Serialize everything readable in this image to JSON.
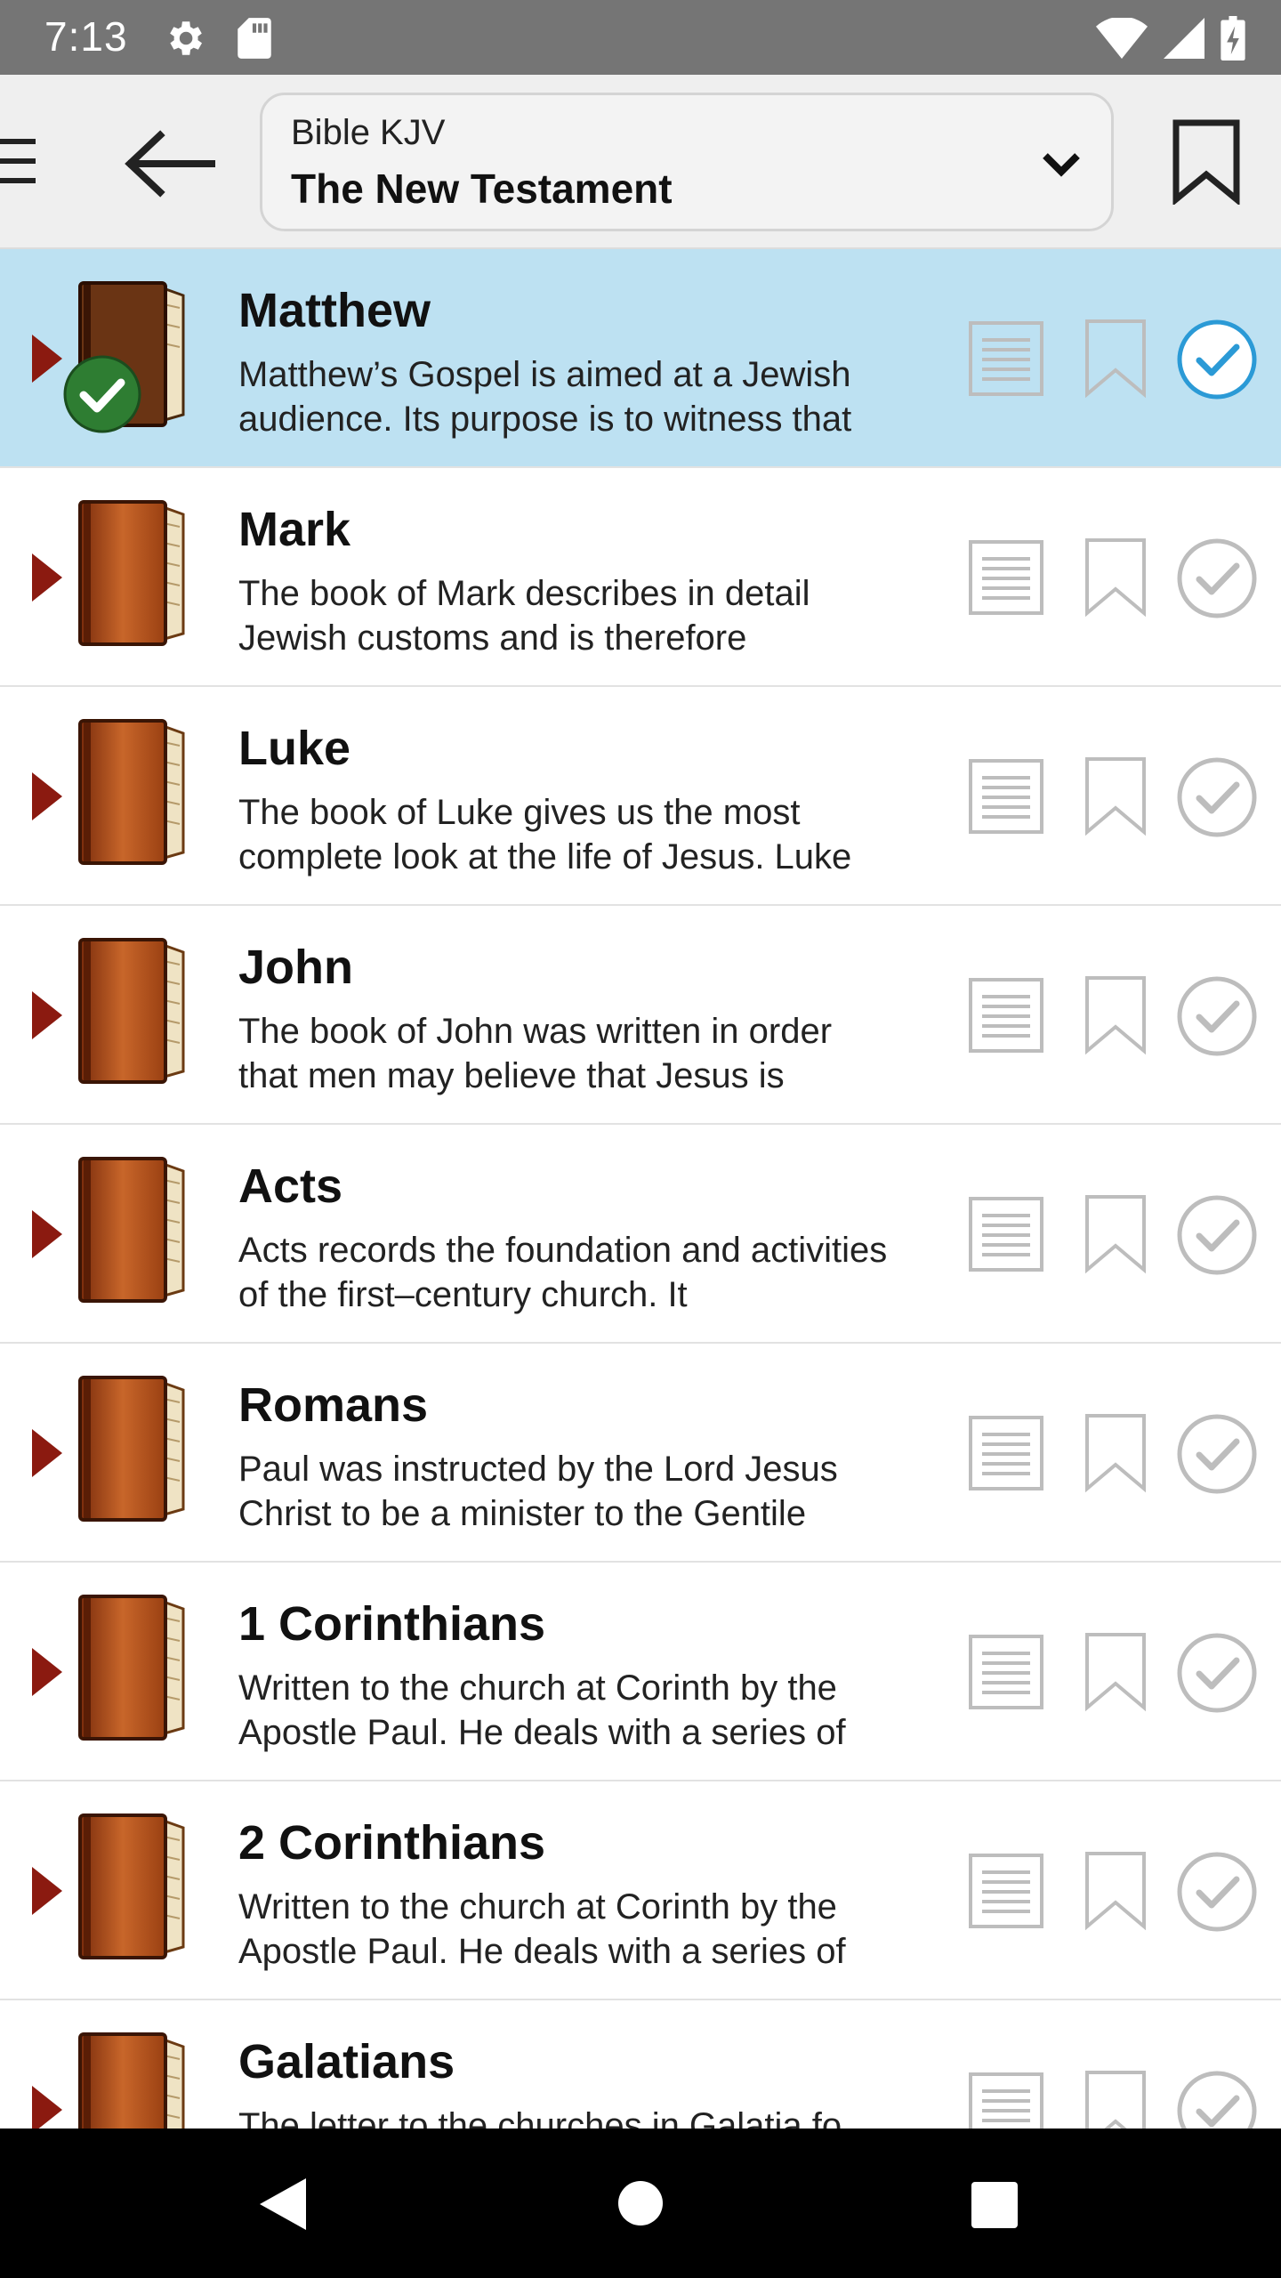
{
  "status_bar": {
    "time": "7:13",
    "icons": [
      "gear-icon",
      "sd-card-icon",
      "wifi-icon",
      "signal-icon",
      "battery-charging-icon"
    ]
  },
  "app_bar": {
    "menu_icon": "hamburger-menu-icon",
    "back_icon": "arrow-left-icon",
    "selector_subtitle": "Bible KJV",
    "selector_title": "The New Testament",
    "selector_icon": "chevron-down-icon",
    "bookmark_icon": "bookmark-icon"
  },
  "colors": {
    "status_bar": "#757575",
    "app_bar": "#efefef",
    "selected_row": "#bde1f2",
    "accent_blue": "#2b9ad6",
    "arrow_red": "#8b1a10",
    "book_brown": "#b8561b",
    "check_green": "#2e7d32",
    "icon_gray": "#bdbdbd"
  },
  "books": [
    {
      "name": "Matthew",
      "description": "Matthew’s Gospel is aimed at a Jewish audience. Its purpose is to witness that",
      "selected": true,
      "completed": true
    },
    {
      "name": "Mark",
      "description": "The book of Mark describes in detail Jewish customs and is therefore",
      "selected": false,
      "completed": false
    },
    {
      "name": "Luke",
      "description": "The book of Luke gives us the most complete look at the life of Jesus. Luke",
      "selected": false,
      "completed": false
    },
    {
      "name": "John",
      "description": "The book of John was written in order that men may believe that Jesus is",
      "selected": false,
      "completed": false
    },
    {
      "name": "Acts",
      "description": "Acts records the foundation and activities of the first–century church. It",
      "selected": false,
      "completed": false
    },
    {
      "name": "Romans",
      "description": "Paul was instructed by the Lord Jesus Christ to be a minister to the Gentile",
      "selected": false,
      "completed": false
    },
    {
      "name": "1 Corinthians",
      "description": "Written to the church at Corinth by the Apostle Paul. He deals with a series of",
      "selected": false,
      "completed": false
    },
    {
      "name": "2 Corinthians",
      "description": "Written to the church at Corinth by the Apostle Paul. He deals with a series of",
      "selected": false,
      "completed": false
    },
    {
      "name": "Galatians",
      "description": "The letter to the churches in Galatia fo",
      "selected": false,
      "completed": false
    }
  ],
  "nav_bar": {
    "icons": [
      "nav-back-icon",
      "nav-home-icon",
      "nav-recents-icon"
    ]
  }
}
